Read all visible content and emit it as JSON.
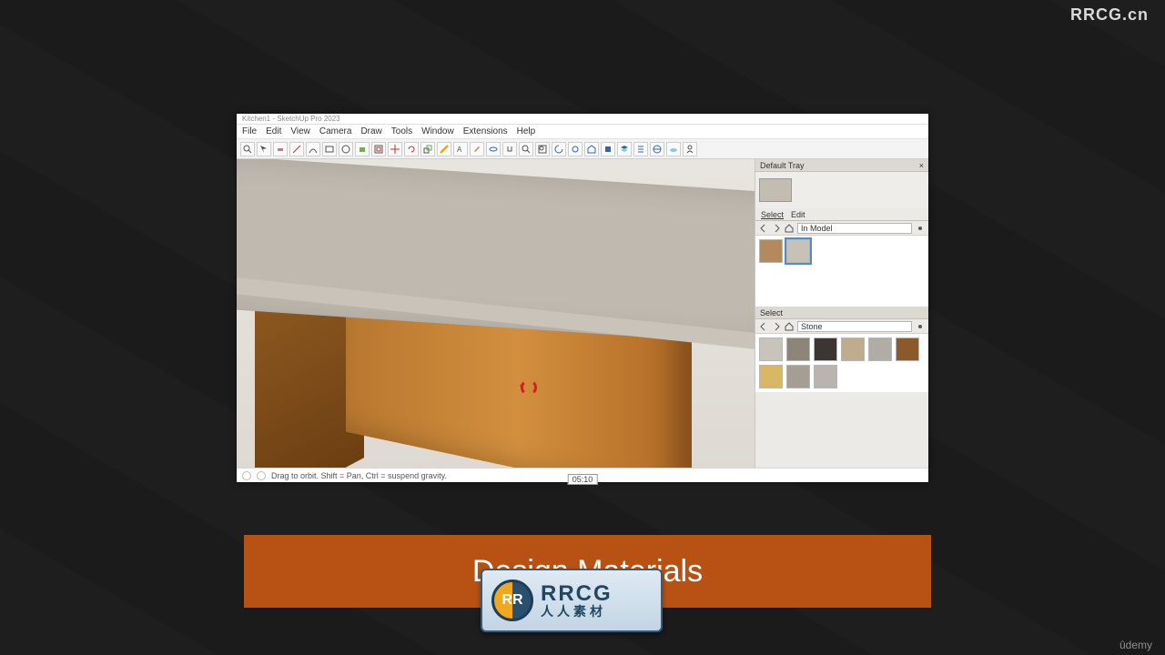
{
  "watermarks": {
    "top_right": "RRCG.cn",
    "bottom_right": "ûdemy"
  },
  "app": {
    "title": "Kitchen1 - SketchUp Pro 2023",
    "menu": [
      "File",
      "Edit",
      "View",
      "Camera",
      "Draw",
      "Tools",
      "Window",
      "Extensions",
      "Help"
    ],
    "status_hint": "Drag to orbit. Shift = Pan, Ctrl = suspend gravity.",
    "timecode": "05:10"
  },
  "tray": {
    "title": "Default Tray",
    "tabs": {
      "select": "Select",
      "edit": "Edit"
    },
    "panel1": {
      "dropdown": "In Model",
      "swatches": [
        {
          "color": "#b28a5c",
          "name": "material-wood"
        },
        {
          "color": "#c7c1b6",
          "name": "material-countertop",
          "selected": true
        }
      ]
    },
    "panel2": {
      "header": "Select",
      "dropdown": "Stone",
      "swatches": [
        {
          "color": "#c9c4bb",
          "name": "stone-light"
        },
        {
          "color": "#8d857a",
          "name": "stone-grey"
        },
        {
          "color": "#3b3634",
          "name": "stone-dark"
        },
        {
          "color": "#bfab8e",
          "name": "stone-tan"
        },
        {
          "color": "#b0aca6",
          "name": "stone-ash"
        },
        {
          "color": "#8a5a2d",
          "name": "stone-brown"
        },
        {
          "color": "#d9b865",
          "name": "stone-gold"
        },
        {
          "color": "#a69e92",
          "name": "stone-warm"
        },
        {
          "color": "#b9b5ae",
          "name": "stone-pale"
        }
      ]
    }
  },
  "toolbar_icons": [
    "search-icon",
    "select-icon",
    "eraser-icon",
    "line-icon",
    "arc-icon",
    "rectangle-icon",
    "circle-icon",
    "pushpull-icon",
    "offset-icon",
    "move-icon",
    "rotate-icon",
    "scale-icon",
    "tape-icon",
    "text-icon",
    "paint-icon",
    "orbit-icon",
    "pan-icon",
    "zoom-icon",
    "zoom-extents-icon",
    "prev-view-icon",
    "next-view-icon",
    "warehouse-icon",
    "extensions-icon",
    "layers-icon",
    "outliner-icon",
    "geo-icon",
    "cloud-icon",
    "user-icon"
  ],
  "banner": {
    "text": "Design Materials"
  },
  "overlay_logo": {
    "mono": "RR",
    "line1": "RRCG",
    "line2": "人人素材"
  }
}
